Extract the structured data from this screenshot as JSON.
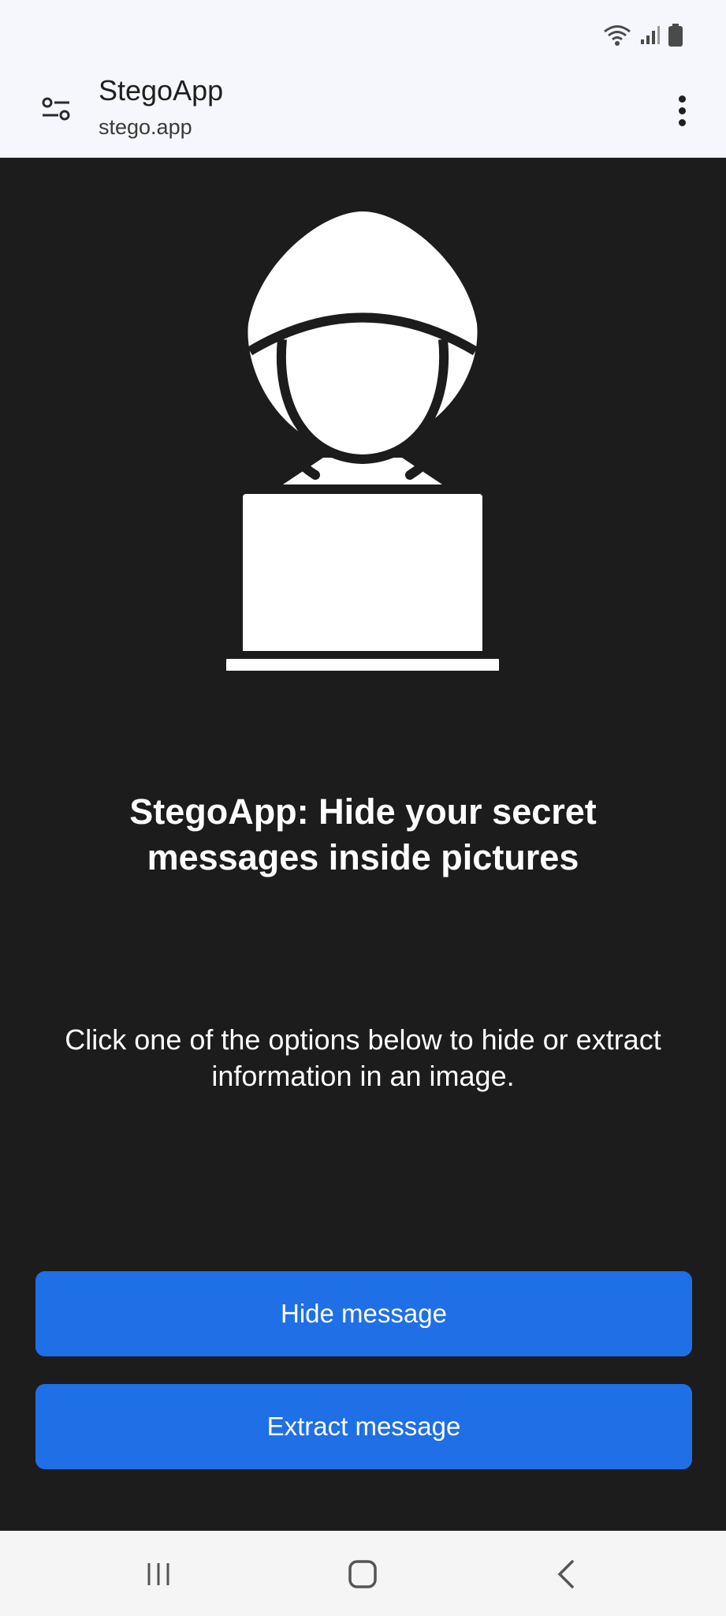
{
  "status_bar": {
    "icons": [
      "wifi-icon",
      "signal-icon",
      "battery-icon"
    ]
  },
  "app_bar": {
    "title": "StegoApp",
    "url": "stego.app",
    "icons": [
      "site-settings-icon",
      "more-vert-icon"
    ]
  },
  "main": {
    "hero_icon": "hacker-laptop-icon",
    "headline": "StegoApp: Hide your secret messages inside pictures",
    "subtext": "Click one of the options below to hide or extract information in an image.",
    "buttons": {
      "hide": "Hide message",
      "extract": "Extract message"
    }
  },
  "nav_bar": {
    "icons": [
      "recent-apps-icon",
      "home-icon",
      "back-icon"
    ]
  },
  "colors": {
    "background": "#1c1c1c",
    "button": "#1f6fe6",
    "bar": "#f5f7fc"
  }
}
